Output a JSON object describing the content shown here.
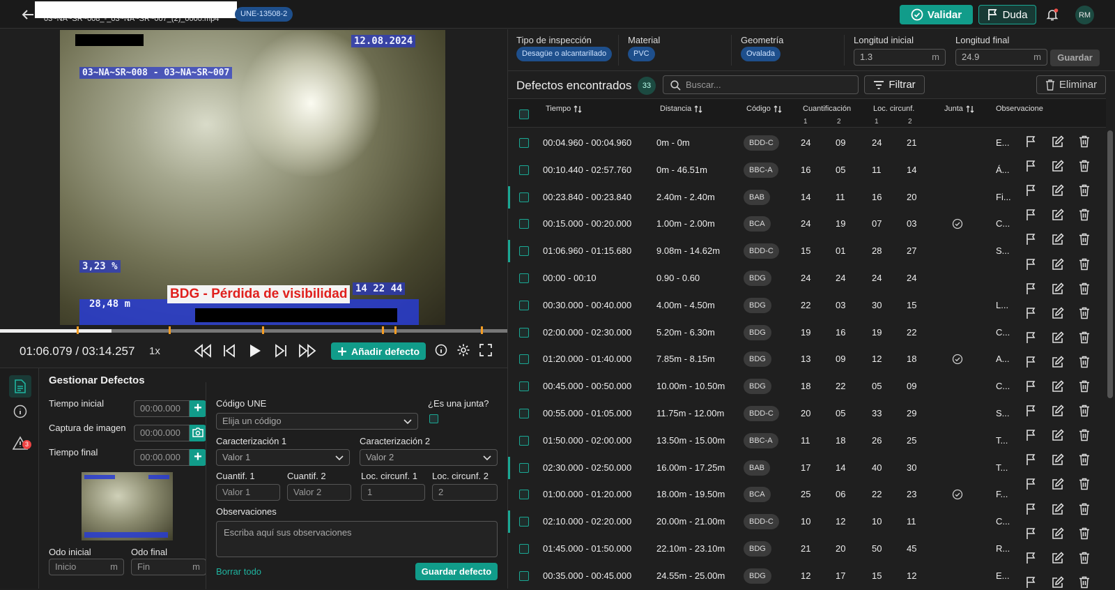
{
  "header": {
    "filename": "03~NA~SR~008_-_03~NA~SR~007_(2)_0000.mp4",
    "norm_chip": "UNE-13508-2",
    "validar_label": "Validar",
    "duda_label": "Duda",
    "avatar_initials": "RM"
  },
  "video": {
    "date_text": "12.08.2024",
    "pipe_text": "03~NA~SR~008 - 03~NA~SR~007",
    "slope_text": "3,23 %",
    "distance_text": "28,48 m",
    "time_text": "14 22 44",
    "defect_overlay": "BDG - Pérdida de visibilidad",
    "progress": 0.22
  },
  "player": {
    "timecode": "01:06.079 / 03:14.257",
    "speed": "1x",
    "add_defect_label": "Añadir defecto"
  },
  "gestionar": {
    "title": "Gestionar Defectos",
    "nav_badge_count": "3",
    "tiempo_inicial_label": "Tiempo inicial",
    "tiempo_inicial_value": "00:00.000",
    "captura_label": "Captura de imagen",
    "captura_value": "00:00.000",
    "tiempo_final_label": "Tiempo final",
    "tiempo_final_value": "00:00.000",
    "odo_inicial_label": "Odo inicial",
    "odo_inicial_placeholder": "Inicio",
    "odo_final_label": "Odo final",
    "odo_final_placeholder": "Fin",
    "unit_m": "m",
    "codigo_label": "Código UNE",
    "codigo_placeholder": "Elija un código",
    "junta_label": "¿Es una junta?",
    "car1_label": "Caracterización 1",
    "car1_placeholder": "Valor 1",
    "car2_label": "Caracterización 2",
    "car2_placeholder": "Valor 2",
    "cuantif1_label": "Cuantif. 1",
    "cuantif1_placeholder": "Valor 1",
    "cuantif2_label": "Cuantif. 2",
    "cuantif2_placeholder": "Valor 2",
    "loc1_label": "Loc. circunf. 1",
    "loc1_placeholder": "1",
    "loc2_label": "Loc. circunf. 2",
    "loc2_placeholder": "2",
    "obs_label": "Observaciones",
    "obs_placeholder": "Escriba aquí sus observaciones",
    "borrar_label": "Borrar todo",
    "guardar_label": "Guardar defecto"
  },
  "inspection": {
    "tipo_label": "Tipo de inspección",
    "tipo_value": "Desagüe o alcantarillado",
    "material_label": "Material",
    "material_value": "PVC",
    "geometria_label": "Geometría",
    "geometria_value": "Ovalada",
    "long_ini_label": "Longitud inicial",
    "long_ini_value": "1.3",
    "long_fin_label": "Longitud final",
    "long_fin_value": "24.9",
    "unit": "m",
    "guardar_label": "Guardar"
  },
  "defects": {
    "title": "Defectos encontrados",
    "count": "33",
    "search_placeholder": "Buscar...",
    "filtrar_label": "Filtrar",
    "eliminar_label": "Eliminar",
    "columns": {
      "tiempo": "Tiempo",
      "distancia": "Distancia",
      "codigo": "Código",
      "cuantificacion": "Cuantificación",
      "loc": "Loc. circunf.",
      "junta": "Junta",
      "observaciones": "Observacione",
      "sub1": "1",
      "sub2": "2"
    },
    "rows": [
      {
        "tiempo": "00:04.960 - 00:04.960",
        "distancia": "0m - 0m",
        "codigo": "BDD-C",
        "q1": "24",
        "q2": "09",
        "l1": "24",
        "l2": "21",
        "junta": false,
        "obs": "E...",
        "accent": false
      },
      {
        "tiempo": "00:10.440 - 02:57.760",
        "distancia": "0m - 46.51m",
        "codigo": "BBC-A",
        "q1": "16",
        "q2": "05",
        "l1": "11",
        "l2": "14",
        "junta": false,
        "obs": "Á...",
        "accent": false
      },
      {
        "tiempo": "00:23.840 - 00:23.840",
        "distancia": "2.40m - 2.40m",
        "codigo": "BAB",
        "q1": "14",
        "q2": "11",
        "l1": "16",
        "l2": "20",
        "junta": false,
        "obs": "Fi...",
        "accent": true
      },
      {
        "tiempo": "00:15.000 - 00:20.000",
        "distancia": "1.00m - 2.00m",
        "codigo": "BCA",
        "q1": "24",
        "q2": "19",
        "l1": "07",
        "l2": "03",
        "junta": true,
        "obs": "C...",
        "accent": false
      },
      {
        "tiempo": "01:06.960 - 01:15.680",
        "distancia": "9.08m - 14.62m",
        "codigo": "BDD-C",
        "q1": "15",
        "q2": "01",
        "l1": "28",
        "l2": "27",
        "junta": false,
        "obs": "S...",
        "accent": true
      },
      {
        "tiempo": "00:00 - 00:10",
        "distancia": "0.90 - 0.60",
        "codigo": "BDG",
        "q1": "24",
        "q2": "24",
        "l1": "24",
        "l2": "24",
        "junta": false,
        "obs": "",
        "accent": false
      },
      {
        "tiempo": "00:30.000 - 00:40.000",
        "distancia": "4.00m - 4.50m",
        "codigo": "BDG",
        "q1": "22",
        "q2": "03",
        "l1": "30",
        "l2": "15",
        "junta": false,
        "obs": "L...",
        "accent": false
      },
      {
        "tiempo": "02:00.000 - 02:30.000",
        "distancia": "5.20m - 6.30m",
        "codigo": "BDG",
        "q1": "19",
        "q2": "16",
        "l1": "19",
        "l2": "22",
        "junta": false,
        "obs": "C...",
        "accent": false
      },
      {
        "tiempo": "01:20.000 - 01:40.000",
        "distancia": "7.85m - 8.15m",
        "codigo": "BDG",
        "q1": "13",
        "q2": "09",
        "l1": "12",
        "l2": "18",
        "junta": true,
        "obs": "A...",
        "accent": false
      },
      {
        "tiempo": "00:45.000 - 00:50.000",
        "distancia": "10.00m - 10.50m",
        "codigo": "BDG",
        "q1": "18",
        "q2": "22",
        "l1": "05",
        "l2": "09",
        "junta": false,
        "obs": "C...",
        "accent": false
      },
      {
        "tiempo": "00:55.000 - 01:05.000",
        "distancia": "11.75m - 12.00m",
        "codigo": "BDD-C",
        "q1": "20",
        "q2": "05",
        "l1": "33",
        "l2": "29",
        "junta": false,
        "obs": "S...",
        "accent": false
      },
      {
        "tiempo": "01:50.000 - 02:00.000",
        "distancia": "13.50m - 15.00m",
        "codigo": "BBC-A",
        "q1": "11",
        "q2": "18",
        "l1": "26",
        "l2": "25",
        "junta": false,
        "obs": "T...",
        "accent": false
      },
      {
        "tiempo": "02:30.000 - 02:50.000",
        "distancia": "16.00m - 17.25m",
        "codigo": "BAB",
        "q1": "17",
        "q2": "14",
        "l1": "40",
        "l2": "30",
        "junta": false,
        "obs": "T...",
        "accent": true
      },
      {
        "tiempo": "01:00.000 - 01:20.000",
        "distancia": "18.00m - 19.50m",
        "codigo": "BCA",
        "q1": "25",
        "q2": "06",
        "l1": "22",
        "l2": "23",
        "junta": true,
        "obs": "F...",
        "accent": false
      },
      {
        "tiempo": "02:10.000 - 02:20.000",
        "distancia": "20.00m - 21.00m",
        "codigo": "BDD-C",
        "q1": "10",
        "q2": "12",
        "l1": "10",
        "l2": "11",
        "junta": false,
        "obs": "C...",
        "accent": true
      },
      {
        "tiempo": "01:45.000 - 01:50.000",
        "distancia": "22.10m - 23.10m",
        "codigo": "BDG",
        "q1": "21",
        "q2": "20",
        "l1": "50",
        "l2": "45",
        "junta": false,
        "obs": "R...",
        "accent": false
      },
      {
        "tiempo": "00:35.000 - 00:45.000",
        "distancia": "24.55m - 25.00m",
        "codigo": "BDG",
        "q1": "12",
        "q2": "17",
        "l1": "15",
        "l2": "12",
        "junta": false,
        "obs": "E...",
        "accent": false
      }
    ]
  },
  "icons": {
    "back": "arrow-left-icon",
    "validar": "check-circle-icon",
    "duda": "flag-icon",
    "bell": "bell-icon",
    "search": "search-icon",
    "filter": "filter-icon",
    "trash": "trash-icon",
    "edit": "edit-icon",
    "camera": "camera-icon"
  },
  "colors": {
    "accent": "#119c8a",
    "chip_blue": "#1e4f8c",
    "marker": "#f59d23"
  }
}
